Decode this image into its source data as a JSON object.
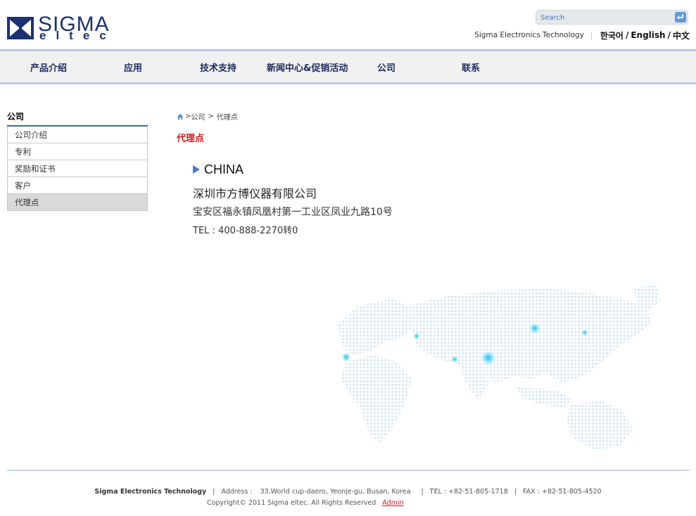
{
  "header": {
    "logo_text_top": "SIGMA",
    "logo_text_bottom": "eltec",
    "search_placeholder": "Search",
    "company_link": "Sigma Electronics Technology",
    "languages": [
      "한국어",
      "English",
      "中文"
    ]
  },
  "nav": {
    "items": [
      "产品介绍",
      "应用",
      "技术支持",
      "新闻中心&促销活动",
      "公司",
      "联系"
    ]
  },
  "sidebar": {
    "title": "公司",
    "items": [
      "公司介绍",
      "专利",
      "奖励和证书",
      "客户",
      "代理点"
    ],
    "active_index": 4
  },
  "breadcrumb": {
    "separator": ">",
    "items": [
      "公司",
      "代理点"
    ]
  },
  "page_title": "代理点",
  "address": {
    "country": "CHINA",
    "company": "深圳市方博仪器有限公司",
    "street": "宝安区福永镇凤凰村第一工业区凤业九路10号",
    "tel": "TEL : 400-888-2270转0"
  },
  "footer": {
    "company": "Sigma Electronics Technology",
    "address_label": "Address :",
    "address_value": "33,World cup-daero, Yeonje-gu, Busan, Korea",
    "tel": "TEL : +82-51-805-1718",
    "fax": "FAX : +82-51-805-4520",
    "copyright": "Copyright© 2011 Sigma eltec. All Rights Reserved",
    "admin_link": "Admin"
  },
  "colors": {
    "brand_blue": "#1b3170",
    "accent_red": "#cc1b1b",
    "nav_border": "#b9cbe6",
    "map_dot": "#dbe9f6",
    "map_highlight": "#27c5f2"
  }
}
